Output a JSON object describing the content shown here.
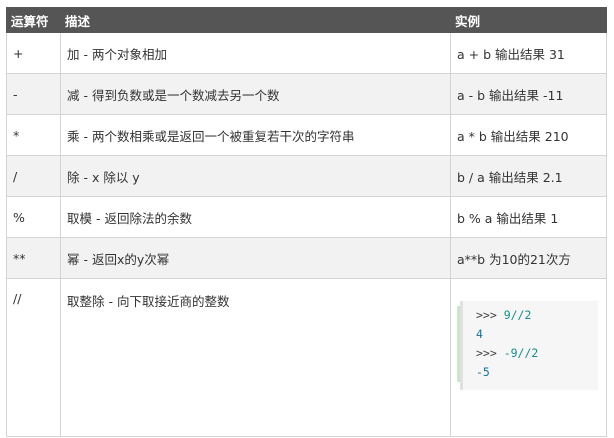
{
  "table": {
    "headers": [
      "运算符",
      "描述",
      "实例"
    ],
    "rows": [
      {
        "op": "+",
        "desc": "加 - 两个对象相加",
        "example": "a + b 输出结果 31"
      },
      {
        "op": "-",
        "desc": "减 - 得到负数或是一个数减去另一个数",
        "example": "a - b 输出结果 -11"
      },
      {
        "op": "*",
        "desc": "乘 - 两个数相乘或是返回一个被重复若干次的字符串",
        "example": "a * b 输出结果 210"
      },
      {
        "op": "/",
        "desc": "除 - x 除以 y",
        "example": "b / a 输出结果 2.1"
      },
      {
        "op": "%",
        "desc": "取模 - 返回除法的余数",
        "example": "b % a 输出结果 1"
      },
      {
        "op": "**",
        "desc": "幂 - 返回x的y次幂",
        "example": "a**b 为10的21次方"
      },
      {
        "op": "//",
        "desc": "取整除 - 向下取接近商的整数",
        "example": ""
      }
    ],
    "code_example": [
      {
        "prompt": ">>> ",
        "expr": "9//2"
      },
      {
        "output": "4"
      },
      {
        "prompt": ">>> ",
        "expr": "-9//2"
      },
      {
        "output": "-5"
      }
    ]
  }
}
